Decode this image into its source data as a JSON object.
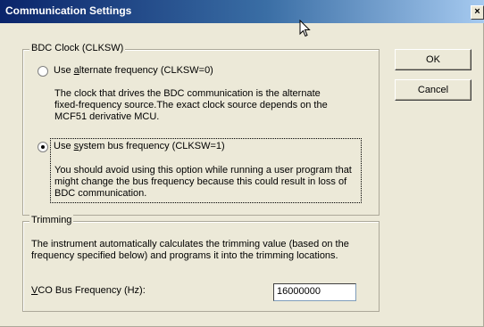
{
  "window": {
    "title": "Communication Settings",
    "close_label": "×"
  },
  "bdc_group": {
    "legend": "BDC Clock (CLKSW)",
    "options": [
      {
        "label_pre": "Use ",
        "label_key": "a",
        "label_post": "lternate frequency (CLKSW=0)",
        "checked": false,
        "description": "The clock that drives the BDC communication is the alternate\nfixed-frequency source.The exact clock source depends on the\nMCF51 derivative MCU."
      },
      {
        "label_pre": "Use ",
        "label_key": "s",
        "label_post": "ystem bus frequency (CLKSW=1)",
        "checked": true,
        "description": "You should avoid using this option while running a user program that\nmight change the bus frequency because this could result in loss of\nBDC communication."
      }
    ]
  },
  "trim_group": {
    "legend": "Trimming",
    "description": "The instrument automatically calculates the trimming value (based on the\nfrequency specified below) and programs it into the trimming locations.",
    "vco_label_key": "V",
    "vco_label_rest": "CO Bus Frequency (Hz):",
    "vco_value": "16000000"
  },
  "buttons": {
    "ok": "OK",
    "cancel": "Cancel"
  }
}
